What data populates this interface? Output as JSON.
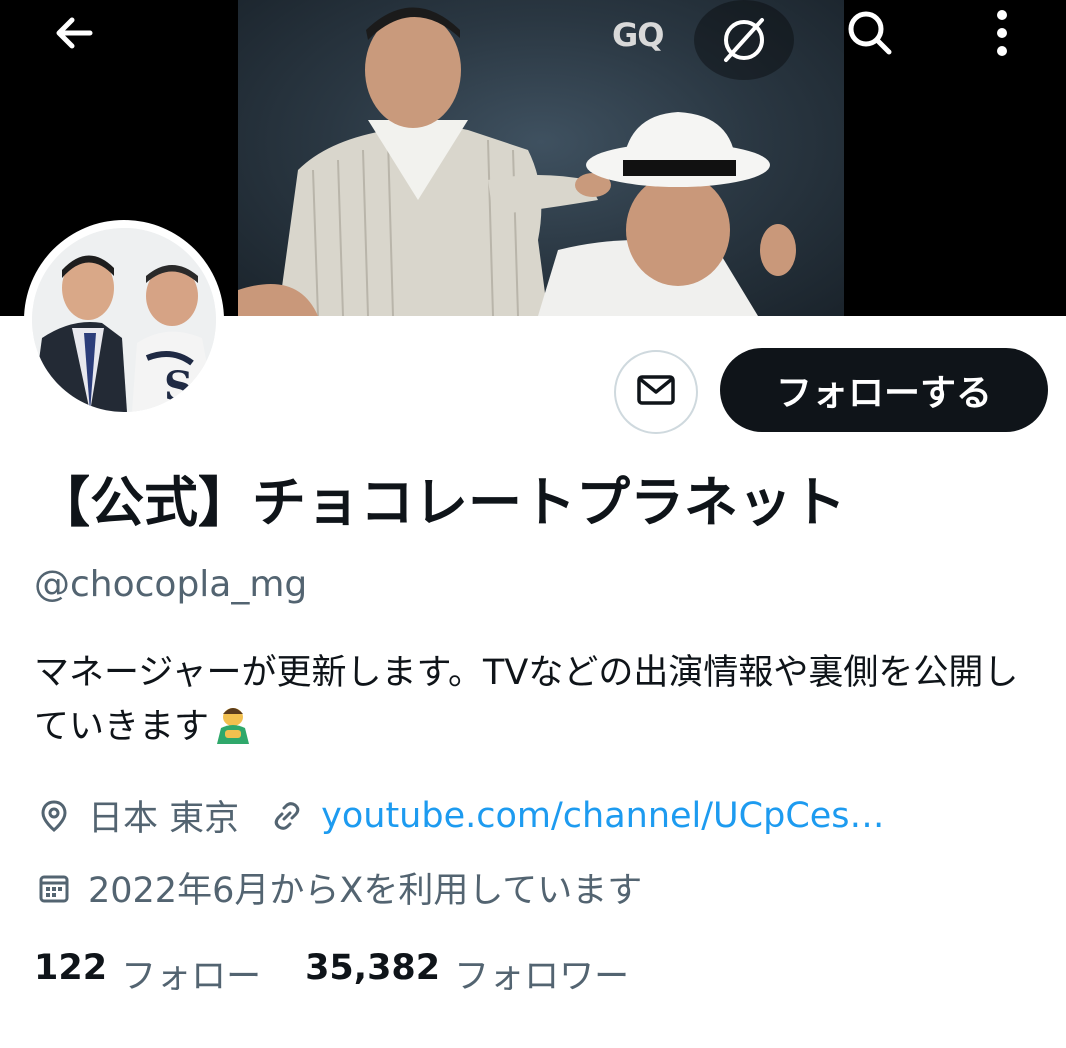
{
  "header": {
    "back_icon": "arrow-left-icon",
    "search_icon": "search-icon",
    "more_icon": "more-vertical-icon",
    "banner_logo_text": "GQ"
  },
  "profile": {
    "display_name": "【公式】チョコレートプラネット",
    "handle": "@chocopla_mg",
    "bio": "マネージャーが更新します。TVなどの出演情報や裏側を公開していきます",
    "bio_emoji": "person-bowing-emoji",
    "location": "日本 東京",
    "website": "youtube.com/channel/UCpCes…",
    "joined": "2022年6月からXを利用しています"
  },
  "actions": {
    "message_icon": "envelope-icon",
    "follow_label": "フォローする"
  },
  "stats": {
    "following_count": "122",
    "following_label": "フォロー",
    "followers_count": "35,382",
    "followers_label": "フォロワー"
  },
  "colors": {
    "text_primary": "#0f1419",
    "text_secondary": "#536471",
    "link": "#1d9bf0",
    "follow_button_bg": "#0f1419",
    "border": "#cfd9de"
  }
}
